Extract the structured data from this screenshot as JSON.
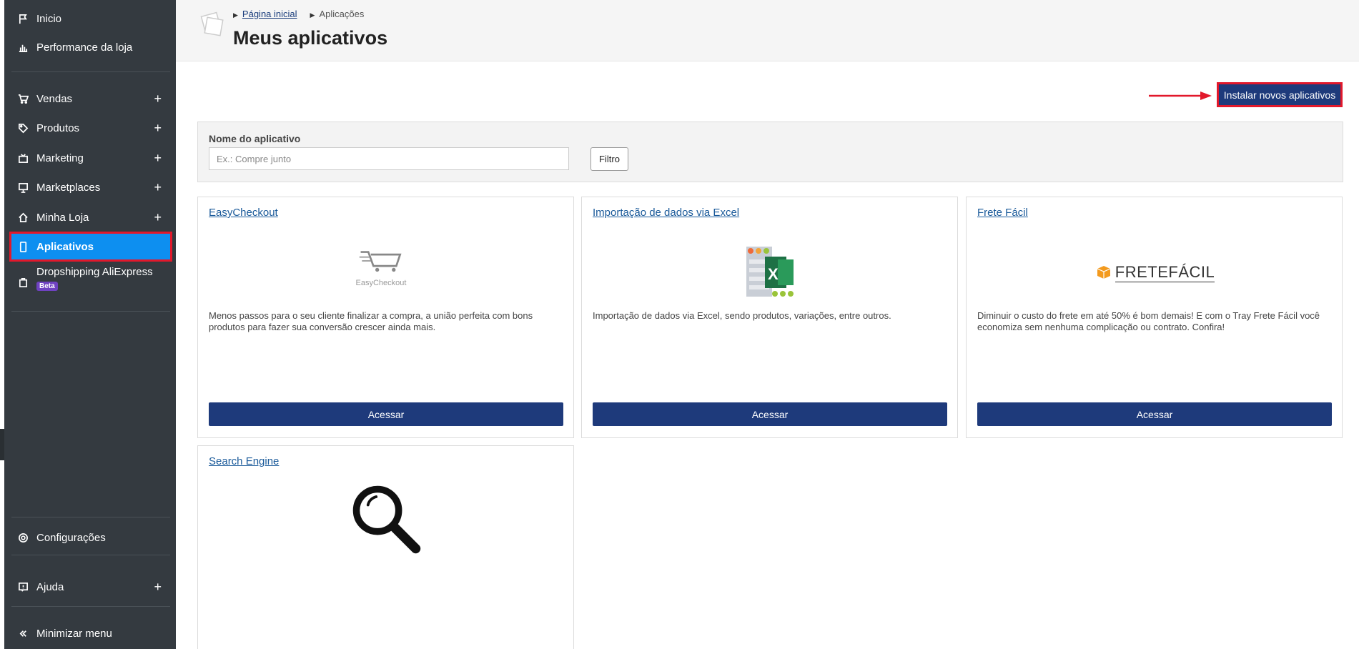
{
  "sidebar": {
    "items": [
      {
        "label": "Inicio",
        "icon": "flag-icon"
      },
      {
        "label": "Performance da loja",
        "icon": "bar-chart-icon"
      },
      {
        "label": "Vendas",
        "icon": "cart-icon",
        "expand": "+"
      },
      {
        "label": "Produtos",
        "icon": "tag-icon",
        "expand": "+"
      },
      {
        "label": "Marketing",
        "icon": "tv-icon",
        "expand": "+"
      },
      {
        "label": "Marketplaces",
        "icon": "monitor-icon",
        "expand": "+"
      },
      {
        "label": "Minha Loja",
        "icon": "home-icon",
        "expand": "+"
      },
      {
        "label": "Aplicativos",
        "icon": "phone-icon"
      },
      {
        "label": "Dropshipping AliExpress",
        "icon": "bag-icon",
        "badge": "Beta"
      },
      {
        "label": "Configurações",
        "icon": "gear-icon"
      },
      {
        "label": "Ajuda",
        "icon": "help-icon",
        "expand": "+"
      },
      {
        "label": "Minimizar menu",
        "icon": "double-chevron-left-icon"
      }
    ],
    "active_color": "#0d8ff0"
  },
  "header": {
    "breadcrumb": [
      "Página inicial",
      "Aplicações"
    ],
    "title": "Meus aplicativos"
  },
  "actions": {
    "install_label": "Instalar novos aplicativos"
  },
  "filter": {
    "label": "Nome do aplicativo",
    "placeholder": "Ex.: Compre junto",
    "value": "",
    "button": "Filtro"
  },
  "apps": [
    {
      "title": "EasyCheckout",
      "logo_text": "EasyCheckout",
      "description": "Menos passos para o seu cliente finalizar a compra, a união perfeita com bons produtos para fazer sua conversão crescer ainda mais.",
      "button": "Acessar"
    },
    {
      "title": "Importação de dados via Excel",
      "description": "Importação de dados via Excel, sendo produtos, variações, entre outros.",
      "button": "Acessar"
    },
    {
      "title": "Frete Fácil",
      "logo_text": "FRETEFÁCIL",
      "description": "Diminuir o custo do frete em até 50% é bom demais! E com o Tray Frete Fácil você economiza sem nenhuma complicação ou contrato. Confira!",
      "button": "Acessar"
    },
    {
      "title": "Search Engine"
    }
  ],
  "colors": {
    "sidebar_bg": "#343a40",
    "primary_button": "#1e3a7b",
    "highlight_border": "#e2182b"
  }
}
